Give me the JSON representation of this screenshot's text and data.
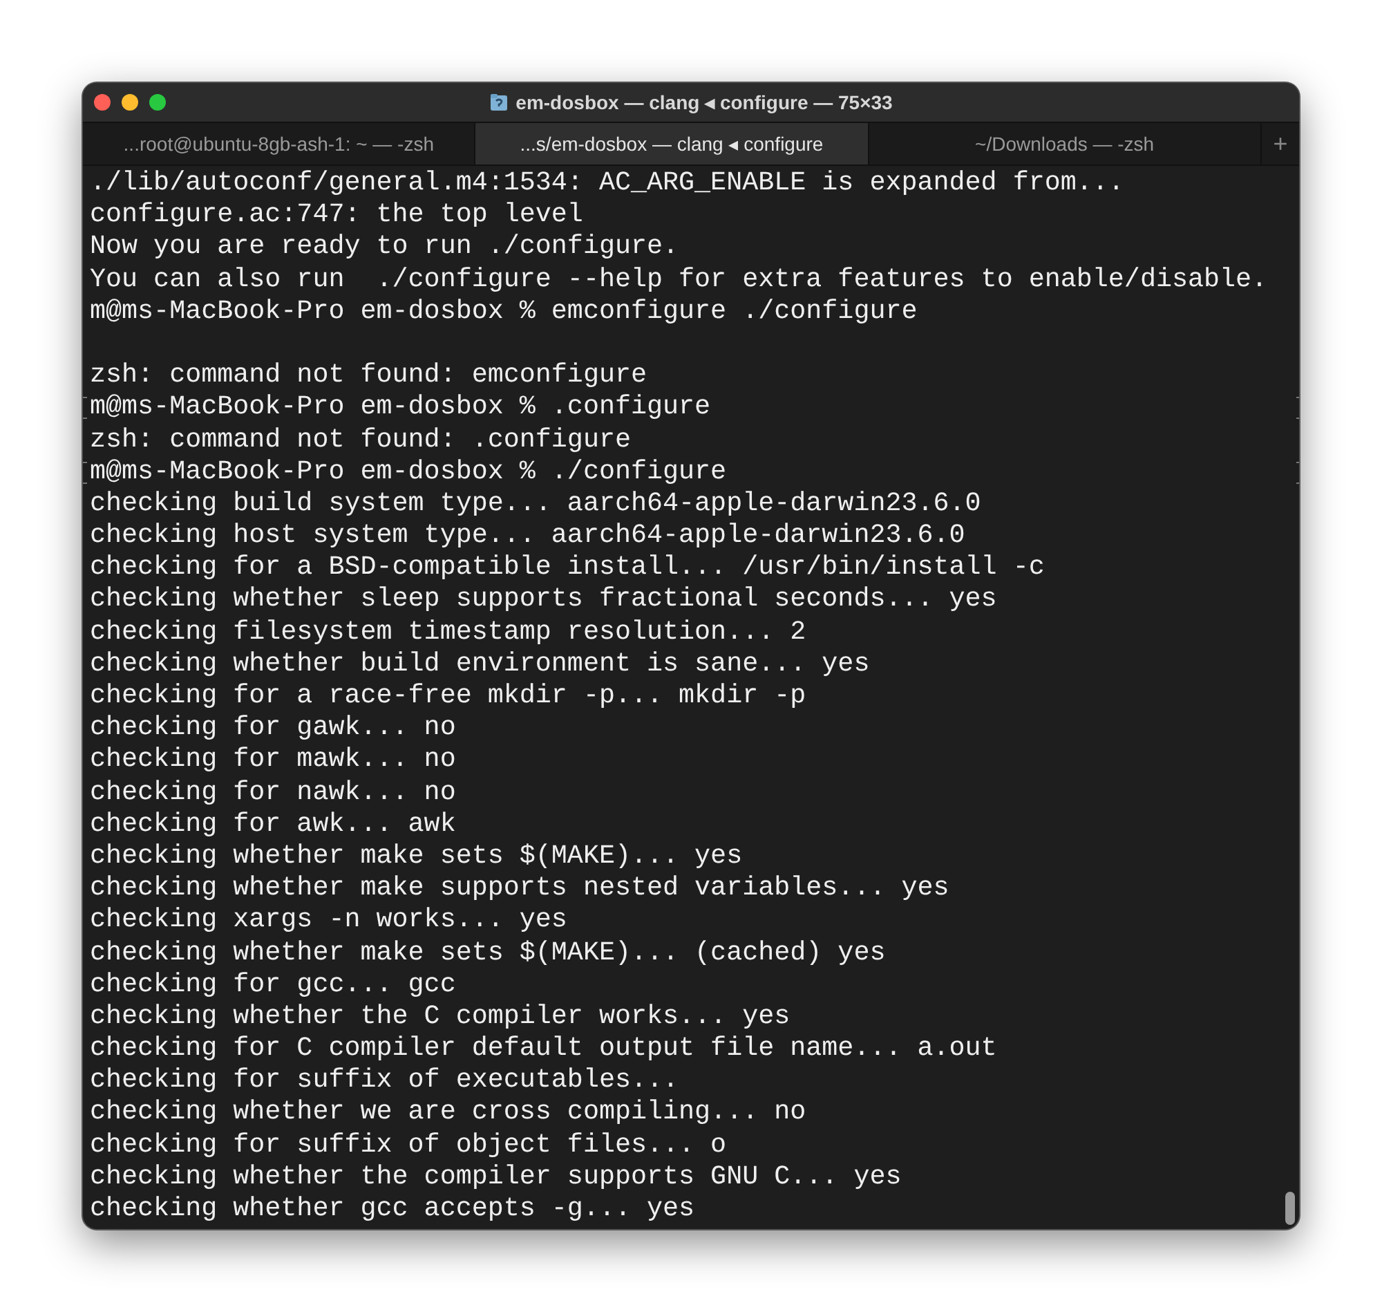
{
  "window": {
    "title": "em-dosbox — clang ◂ configure — 75×33"
  },
  "tabs": [
    {
      "label": "...root@ubuntu-8gb-ash-1: ~ — -zsh",
      "selected": false
    },
    {
      "label": "...s/em-dosbox — clang ◂ configure",
      "selected": true
    },
    {
      "label": "~/Downloads — -zsh",
      "selected": false
    }
  ],
  "new_tab_button": "+",
  "lines": [
    {
      "kind": "text",
      "text": "./lib/autoconf/general.m4:1534: AC_ARG_ENABLE is expanded from...",
      "marked": false
    },
    {
      "kind": "text",
      "text": "configure.ac:747: the top level",
      "marked": false
    },
    {
      "kind": "text",
      "text": "Now you are ready to run ./configure.",
      "marked": false
    },
    {
      "kind": "text",
      "text": "You can also run  ./configure --help for extra features to enable/disable.",
      "marked": false
    },
    {
      "kind": "text",
      "text": "m@ms-MacBook-Pro em-dosbox % emconfigure ./configure",
      "marked": false
    },
    {
      "kind": "blank"
    },
    {
      "kind": "text",
      "text": "zsh: command not found: emconfigure",
      "marked": false
    },
    {
      "kind": "text",
      "text": "m@ms-MacBook-Pro em-dosbox % .configure",
      "marked": true
    },
    {
      "kind": "text",
      "text": "zsh: command not found: .configure",
      "marked": false
    },
    {
      "kind": "text",
      "text": "m@ms-MacBook-Pro em-dosbox % ./configure",
      "marked": true
    },
    {
      "kind": "text",
      "text": "checking build system type... aarch64-apple-darwin23.6.0",
      "marked": false
    },
    {
      "kind": "text",
      "text": "checking host system type... aarch64-apple-darwin23.6.0",
      "marked": false
    },
    {
      "kind": "text",
      "text": "checking for a BSD-compatible install... /usr/bin/install -c",
      "marked": false
    },
    {
      "kind": "text",
      "text": "checking whether sleep supports fractional seconds... yes",
      "marked": false
    },
    {
      "kind": "text",
      "text": "checking filesystem timestamp resolution... 2",
      "marked": false
    },
    {
      "kind": "text",
      "text": "checking whether build environment is sane... yes",
      "marked": false
    },
    {
      "kind": "text",
      "text": "checking for a race-free mkdir -p... mkdir -p",
      "marked": false
    },
    {
      "kind": "text",
      "text": "checking for gawk... no",
      "marked": false
    },
    {
      "kind": "text",
      "text": "checking for mawk... no",
      "marked": false
    },
    {
      "kind": "text",
      "text": "checking for nawk... no",
      "marked": false
    },
    {
      "kind": "text",
      "text": "checking for awk... awk",
      "marked": false
    },
    {
      "kind": "text",
      "text": "checking whether make sets $(MAKE)... yes",
      "marked": false
    },
    {
      "kind": "text",
      "text": "checking whether make supports nested variables... yes",
      "marked": false
    },
    {
      "kind": "text",
      "text": "checking xargs -n works... yes",
      "marked": false
    },
    {
      "kind": "text",
      "text": "checking whether make sets $(MAKE)... (cached) yes",
      "marked": false
    },
    {
      "kind": "text",
      "text": "checking for gcc... gcc",
      "marked": false
    },
    {
      "kind": "text",
      "text": "checking whether the C compiler works... yes",
      "marked": false
    },
    {
      "kind": "text",
      "text": "checking for C compiler default output file name... a.out",
      "marked": false
    },
    {
      "kind": "text",
      "text": "checking for suffix of executables...",
      "marked": false
    },
    {
      "kind": "text",
      "text": "checking whether we are cross compiling... no",
      "marked": false
    },
    {
      "kind": "text",
      "text": "checking for suffix of object files... o",
      "marked": false
    },
    {
      "kind": "text",
      "text": "checking whether the compiler supports GNU C... yes",
      "marked": false
    },
    {
      "kind": "text",
      "text": "checking whether gcc accepts -g... yes",
      "marked": false
    }
  ]
}
